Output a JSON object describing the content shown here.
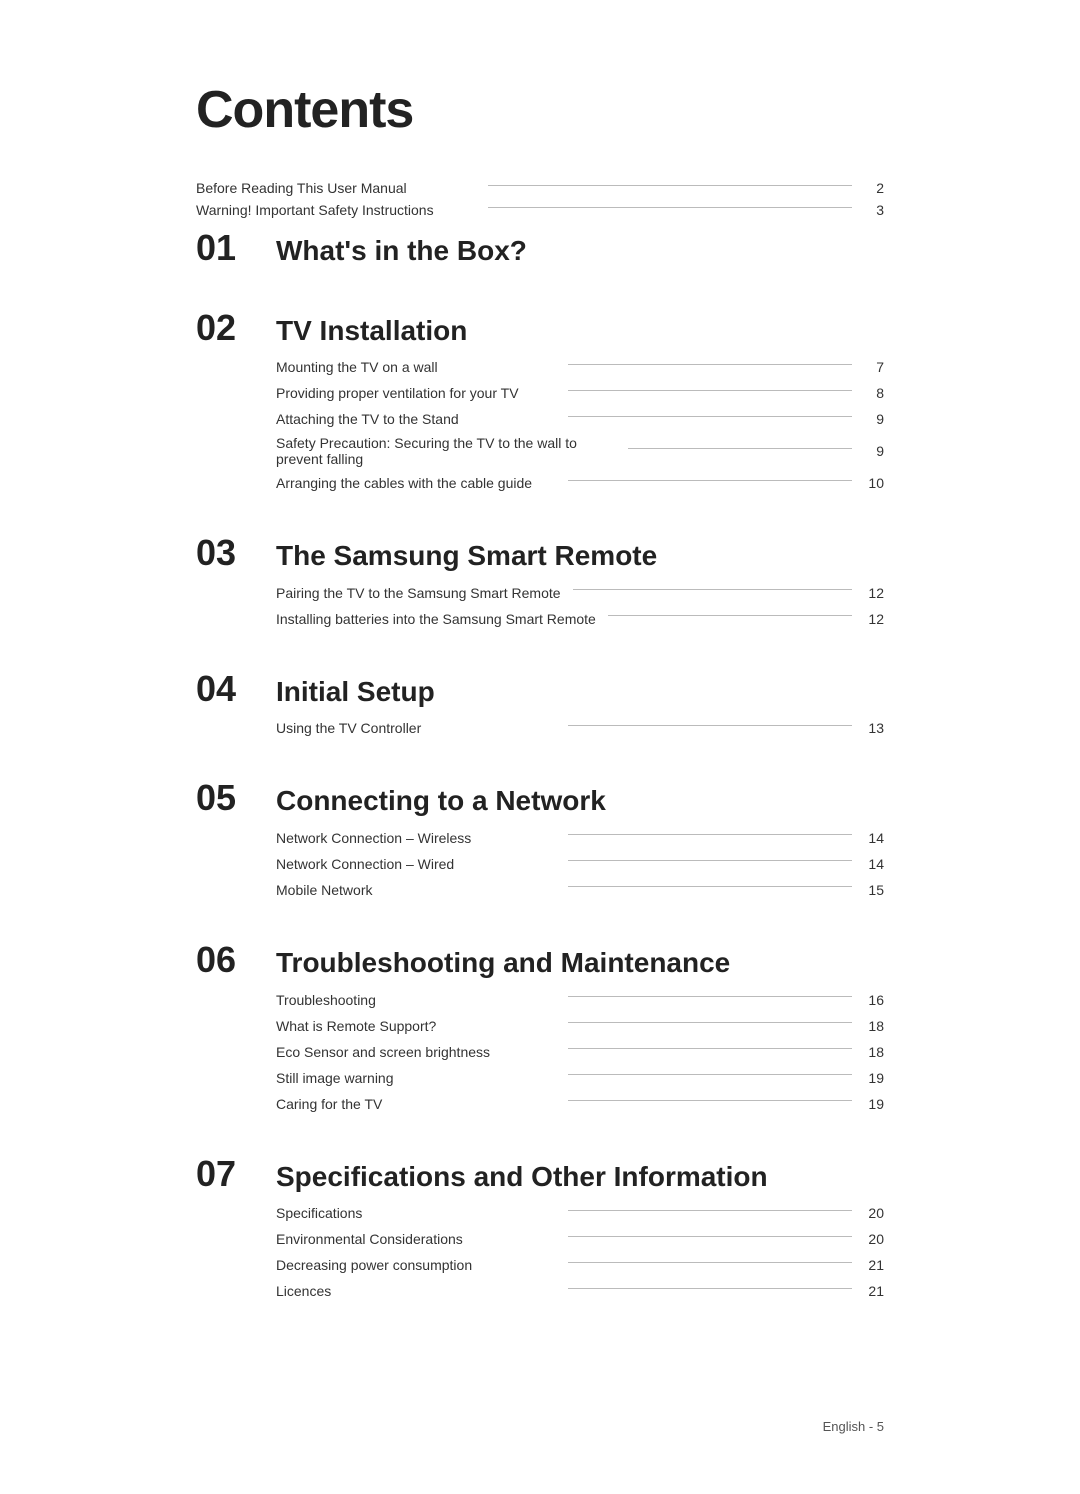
{
  "title": "Contents",
  "intro": [
    {
      "label": "Before Reading This User Manual",
      "page": "2"
    },
    {
      "label": "Warning! Important Safety Instructions",
      "page": "3"
    }
  ],
  "sections": [
    {
      "number": "01",
      "title": "What's in the Box?",
      "items": []
    },
    {
      "number": "02",
      "title": "TV Installation",
      "items": [
        {
          "label": "Mounting the TV on a wall",
          "page": "7"
        },
        {
          "label": "Providing proper ventilation for your TV",
          "page": "8"
        },
        {
          "label": "Attaching the TV to the Stand",
          "page": "9"
        },
        {
          "label": "Safety Precaution: Securing the TV to the wall to prevent falling",
          "page": "9",
          "multiline": true
        },
        {
          "label": "Arranging the cables with the cable guide",
          "page": "10"
        }
      ]
    },
    {
      "number": "03",
      "title": "The Samsung Smart Remote",
      "items": [
        {
          "label": "Pairing the TV to the Samsung Smart Remote",
          "page": "12"
        },
        {
          "label": "Installing batteries into the Samsung Smart Remote",
          "page": "12"
        }
      ]
    },
    {
      "number": "04",
      "title": "Initial Setup",
      "items": [
        {
          "label": "Using the TV Controller",
          "page": "13"
        }
      ]
    },
    {
      "number": "05",
      "title": "Connecting to a Network",
      "items": [
        {
          "label": "Network Connection – Wireless",
          "page": "14"
        },
        {
          "label": "Network Connection – Wired",
          "page": "14"
        },
        {
          "label": "Mobile Network",
          "page": "15"
        }
      ]
    },
    {
      "number": "06",
      "title": "Troubleshooting and Maintenance",
      "items": [
        {
          "label": "Troubleshooting",
          "page": "16"
        },
        {
          "label": "What is Remote Support?",
          "page": "18"
        },
        {
          "label": "Eco Sensor and screen brightness",
          "page": "18"
        },
        {
          "label": "Still image warning",
          "page": "19"
        },
        {
          "label": "Caring for the TV",
          "page": "19"
        }
      ]
    },
    {
      "number": "07",
      "title": "Specifications and Other Information",
      "items": [
        {
          "label": "Specifications",
          "page": "20"
        },
        {
          "label": "Environmental Considerations",
          "page": "20"
        },
        {
          "label": "Decreasing power consumption",
          "page": "21"
        },
        {
          "label": "Licences",
          "page": "21"
        }
      ]
    }
  ],
  "footer": "English - 5"
}
